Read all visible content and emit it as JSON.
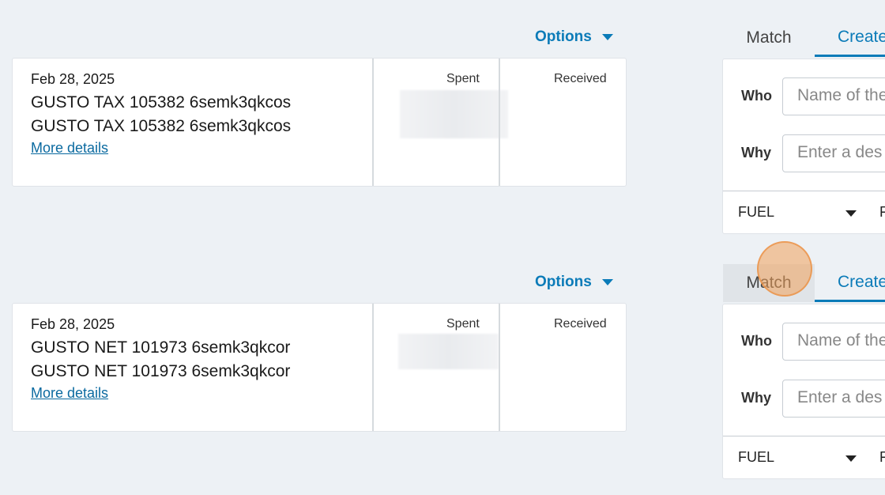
{
  "rows": [
    {
      "options_label": "Options",
      "date": "Feb 28, 2025",
      "desc_line1": "GUSTO TAX 105382 6semk3qkcos",
      "desc_line2": "GUSTO TAX 105382 6semk3qkcos",
      "more_details": "More details",
      "spent_label": "Spent",
      "received_label": "Received",
      "tab_match": "Match",
      "tab_create": "Create",
      "who_label": "Who",
      "who_placeholder": "Name of the",
      "why_label": "Why",
      "why_placeholder": "Enter a des",
      "category": "FUEL",
      "footer_extra": "F"
    },
    {
      "options_label": "Options",
      "date": "Feb 28, 2025",
      "desc_line1": "GUSTO NET 101973 6semk3qkcor",
      "desc_line2": "GUSTO NET 101973 6semk3qkcor",
      "more_details": "More details",
      "spent_label": "Spent",
      "received_label": "Received",
      "tab_match": "Match",
      "tab_create": "Create",
      "who_label": "Who",
      "who_placeholder": "Name of the",
      "why_label": "Why",
      "why_placeholder": "Enter a des",
      "category": "FUEL",
      "footer_extra": "F"
    }
  ],
  "colors": {
    "accent": "#0b7bb8",
    "background": "#edf1f5",
    "click_marker": "#f0a05a"
  },
  "icons": {
    "options_caret": "caret-down-icon",
    "select_caret": "caret-down-icon"
  }
}
